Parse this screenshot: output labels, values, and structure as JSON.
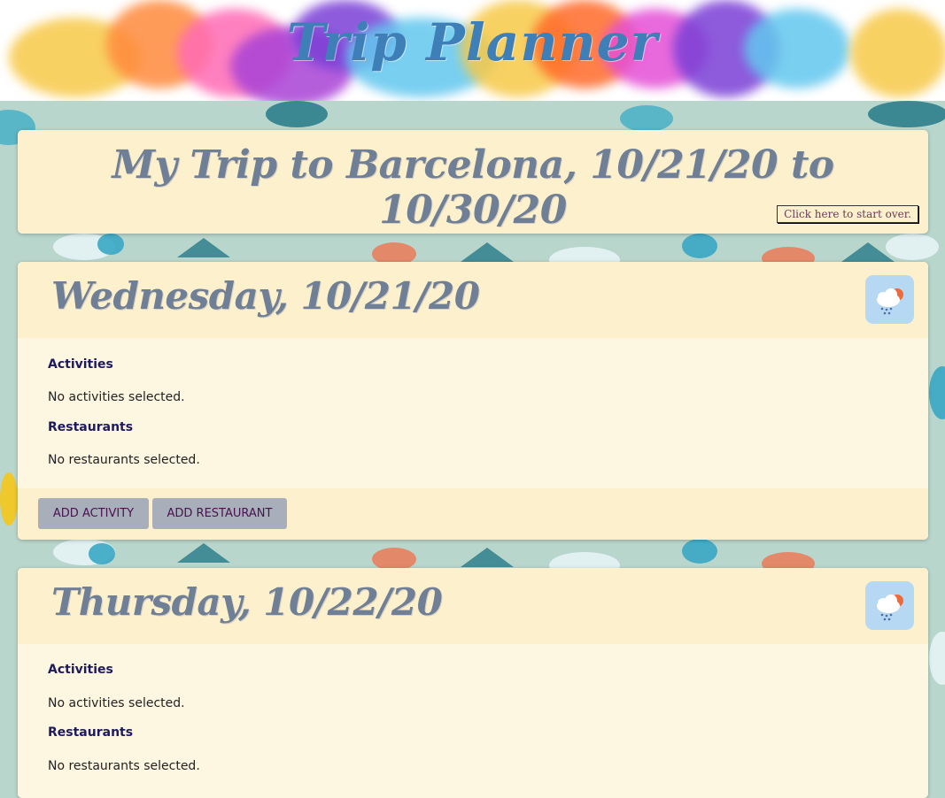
{
  "header": {
    "title": "Trip Planner"
  },
  "trip": {
    "title": "My Trip to Barcelona, 10/21/20 to 10/30/20",
    "start_over_label": "Click here to start over."
  },
  "days": [
    {
      "title": "Wednesday, 10/21/20",
      "weather_icon": "rain-cloud-sun-icon",
      "activities_label": "Activities",
      "activities_empty": "No activities selected.",
      "restaurants_label": "Restaurants",
      "restaurants_empty": "No restaurants selected.",
      "add_activity_label": "Add Activity",
      "add_restaurant_label": "Add Restaurant"
    },
    {
      "title": "Thursday, 10/22/20",
      "weather_icon": "rain-cloud-sun-icon",
      "activities_label": "Activities",
      "activities_empty": "No activities selected.",
      "restaurants_label": "Restaurants",
      "restaurants_empty": "No restaurants selected."
    }
  ],
  "colors": {
    "title_blue": "#3f7fb8",
    "card_bg": "#fdf0cc",
    "day_heading": "#6f7f95",
    "button_bg": "#a9afba",
    "weather_bg": "#b6d8f2"
  }
}
